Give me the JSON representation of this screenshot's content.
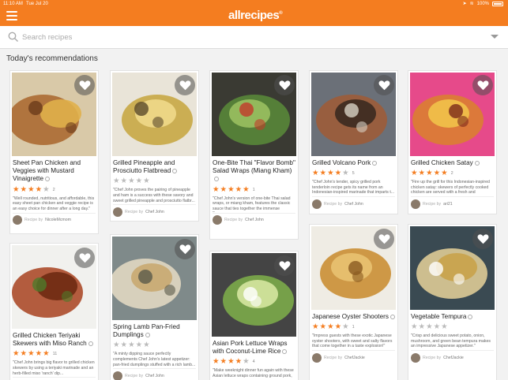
{
  "status": {
    "time": "11:10 AM",
    "date": "Tue Jul 20",
    "battery": "100%"
  },
  "header": {
    "logo": "allrecipes",
    "logo_mark": "®"
  },
  "search": {
    "placeholder": "Search recipes"
  },
  "section_title": "Today's recommendations",
  "byline_prefix": "Recipe by",
  "colors": {
    "brand": "#f47d20",
    "star_on": "#f47d20",
    "star_off": "#bbbbbb"
  },
  "recipes": [
    {
      "title": "Sheet Pan Chicken and Veggies with Mustard Vinaigrette",
      "rating": 4.5,
      "count": "2",
      "desc": "\"Well rounded, nutritious, and affordable, this easy sheet pan chicken and veggie recipe is an easy choice for dinner after a long day.\"",
      "author": "NicoleMcmom"
    },
    {
      "title": "Grilled Pineapple and Prosciutto Flatbread",
      "rating": 0,
      "count": "",
      "desc": "\"Chef John proves the pairing of pineapple and ham is a success with these savory and sweet grilled pineapple and prosciutto flatbr...",
      "author": "Chef John"
    },
    {
      "title": "One-Bite Thai \"Flavor Bomb\" Salad Wraps (Miang Kham)",
      "rating": 5,
      "count": "1",
      "desc": "\"Chef John's version of one-bite Thai salad wraps, or miang kham, features the classic sauce that ties together the immense flavors...",
      "author": "Chef John"
    },
    {
      "title": "Grilled Volcano Pork",
      "rating": 4.5,
      "count": "5",
      "desc": "\"Chef John's tender, spicy grilled pork tenderloin recipe gets its name from an Indonesian-inspired marinade that imparts t...",
      "author": "Chef John"
    },
    {
      "title": "Grilled Chicken Satay",
      "rating": 5,
      "count": "2",
      "desc": "\"Fire up the grill for this Indonesian-inspired chicken satay: skewers of perfectly cooked chicken are served with a fresh and flavorful...",
      "author": "ari21"
    },
    {
      "title": "Grilled Chicken Teriyaki Skewers with Miso Ranch",
      "rating": 5,
      "count": "11",
      "desc": "\"Chef John brings big flavor to grilled chicken skewers by using a teriyaki marinade and an herb-filled miso 'ranch' dip...",
      "author": "Chef John"
    },
    {
      "title": "Spring Lamb Pan-Fried Dumplings",
      "rating": 0,
      "count": "",
      "desc": "\"A minty dipping sauce perfectly complements Chef John's latest appetizer: pan-fried dumplings stuffed with a rich lamb...",
      "author": "Chef John"
    },
    {
      "title": "Asian Pork Lettuce Wraps with Coconut-Lime Rice",
      "rating": 4.5,
      "count": "4",
      "desc": "\"Make weeknight dinner fun again with these Asian lettuce wraps containing ground pork,",
      "author": "Chef John"
    },
    {
      "title": "Japanese Oyster Shooters",
      "rating": 4.5,
      "count": "1",
      "desc": "\"Impress guests with these exotic Japanese oyster shooters, with sweet and salty flavors that come together in a taste explosion!\"",
      "author": "ChefJackie"
    },
    {
      "title": "Vegetable Tempura",
      "rating": 0,
      "count": "",
      "desc": "\"Crisp and delicious sweet potato, onion, mushroom, and green bean tempura makes an impressive Japanese appetizer.\"",
      "author": "ChefJackie"
    }
  ]
}
